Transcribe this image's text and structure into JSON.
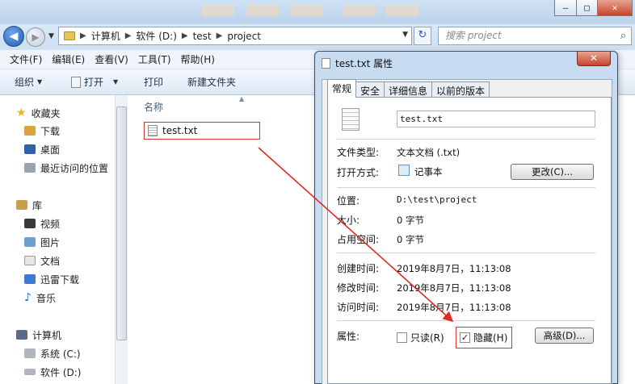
{
  "window": {
    "minimize_glyph": "—",
    "maximize_glyph": "□",
    "close_glyph": "✕"
  },
  "address": {
    "back_glyph": "◀",
    "forward_glyph": "▶",
    "crumbs": [
      "计算机",
      "软件 (D:)",
      "test",
      "project"
    ],
    "separator": "▶",
    "refresh_glyph": "↻",
    "search_placeholder": "搜索 project",
    "search_glyph": "⌕"
  },
  "menu": [
    "文件(F)",
    "编辑(E)",
    "查看(V)",
    "工具(T)",
    "帮助(H)"
  ],
  "toolbar": {
    "organize": "组织",
    "open": "打开",
    "print": "打印",
    "new_folder": "新建文件夹"
  },
  "nav": {
    "favorites": "收藏夹",
    "downloads": "下载",
    "desktop": "桌面",
    "recent": "最近访问的位置",
    "libraries": "库",
    "videos": "视频",
    "pictures": "图片",
    "documents": "文档",
    "xunlei": "迅雷下载",
    "music": "音乐",
    "computer": "计算机",
    "drive_c": "系统 (C:)",
    "drive_d": "软件 (D:)"
  },
  "filelist": {
    "column_name": "名称",
    "sort_glyph": "▲",
    "file_name": "test.txt"
  },
  "dialog": {
    "title": "test.txt 属性",
    "close_glyph": "✕",
    "tabs": [
      "常规",
      "安全",
      "详细信息",
      "以前的版本"
    ],
    "file_name_value": "test.txt",
    "file_type_label": "文件类型:",
    "file_type_value": "文本文档 (.txt)",
    "opens_with_label": "打开方式:",
    "opens_with_value": "记事本",
    "change_button": "更改(C)...",
    "location_label": "位置:",
    "location_value": "D:\\test\\project",
    "size_label": "大小:",
    "size_value": "0 字节",
    "size_on_disk_label": "占用空间:",
    "size_on_disk_value": "0 字节",
    "created_label": "创建时间:",
    "created_value": "2019年8月7日，11:13:08",
    "modified_label": "修改时间:",
    "modified_value": "2019年8月7日，11:13:08",
    "accessed_label": "访问时间:",
    "accessed_value": "2019年8月7日，11:13:08",
    "attributes_label": "属性:",
    "readonly_label": "只读(R)",
    "readonly_checked": false,
    "hidden_label": "隐藏(H)",
    "hidden_checked": true,
    "check_glyph": "✓",
    "advanced_button": "高级(D)..."
  },
  "colors": {
    "annotation_red": "#e02a24",
    "dialog_frame": "#c7dbf1"
  }
}
